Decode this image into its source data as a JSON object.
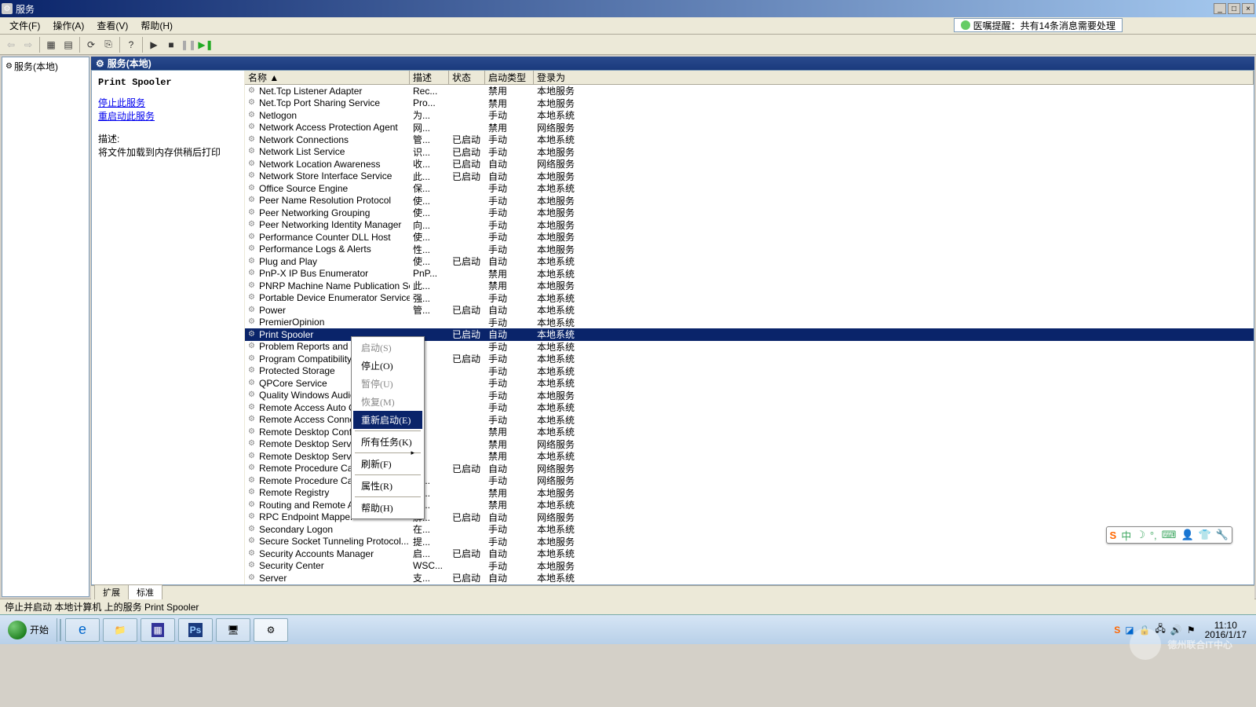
{
  "window": {
    "title": "服务",
    "btn_min": "_",
    "btn_max": "□",
    "btn_close": "×"
  },
  "menu": {
    "items": [
      "文件(F)",
      "操作(A)",
      "查看(V)",
      "帮助(H)"
    ]
  },
  "notification": "医嘱提醒：共有14条消息需要处理",
  "tree": {
    "root": "服务(本地)"
  },
  "header": "服务(本地)",
  "detail": {
    "name": "Print Spooler",
    "link_stop": "停止此服务",
    "link_restart": "重启动此服务",
    "desc_label": "描述:",
    "desc": "将文件加载到内存供稍后打印"
  },
  "columns": {
    "name": "名称 ▲",
    "desc": "描述",
    "status": "状态",
    "startup": "启动类型",
    "logon": "登录为"
  },
  "context_menu": {
    "start": "启动(S)",
    "stop": "停止(O)",
    "pause": "暂停(U)",
    "resume": "恢复(M)",
    "restart": "重新启动(E)",
    "all_tasks": "所有任务(K)",
    "refresh": "刷新(F)",
    "properties": "属性(R)",
    "help": "帮助(H)"
  },
  "tabs": {
    "extended": "扩展",
    "standard": "标准"
  },
  "status_bar": "停止并启动 本地计算机 上的服务 Print Spooler",
  "taskbar": {
    "start": "开始",
    "time": "11:10",
    "date": "2016/1/17"
  },
  "watermark": "德州联合IT中心",
  "services": [
    {
      "n": "Net.Tcp Listener Adapter",
      "d": "Rec...",
      "s": "",
      "t": "禁用",
      "l": "本地服务"
    },
    {
      "n": "Net.Tcp Port Sharing Service",
      "d": "Pro...",
      "s": "",
      "t": "禁用",
      "l": "本地服务"
    },
    {
      "n": "Netlogon",
      "d": "为...",
      "s": "",
      "t": "手动",
      "l": "本地系统"
    },
    {
      "n": "Network Access Protection Agent",
      "d": "网...",
      "s": "",
      "t": "禁用",
      "l": "网络服务"
    },
    {
      "n": "Network Connections",
      "d": "管...",
      "s": "已启动",
      "t": "手动",
      "l": "本地系统"
    },
    {
      "n": "Network List Service",
      "d": "识...",
      "s": "已启动",
      "t": "手动",
      "l": "本地服务"
    },
    {
      "n": "Network Location Awareness",
      "d": "收...",
      "s": "已启动",
      "t": "自动",
      "l": "网络服务"
    },
    {
      "n": "Network Store Interface Service",
      "d": "此...",
      "s": "已启动",
      "t": "自动",
      "l": "本地服务"
    },
    {
      "n": "Office Source Engine",
      "d": "保...",
      "s": "",
      "t": "手动",
      "l": "本地系统"
    },
    {
      "n": "Peer Name Resolution Protocol",
      "d": "使...",
      "s": "",
      "t": "手动",
      "l": "本地服务"
    },
    {
      "n": "Peer Networking Grouping",
      "d": "使...",
      "s": "",
      "t": "手动",
      "l": "本地服务"
    },
    {
      "n": "Peer Networking Identity Manager",
      "d": "向...",
      "s": "",
      "t": "手动",
      "l": "本地服务"
    },
    {
      "n": "Performance Counter DLL Host",
      "d": "使...",
      "s": "",
      "t": "手动",
      "l": "本地服务"
    },
    {
      "n": "Performance Logs & Alerts",
      "d": "性...",
      "s": "",
      "t": "手动",
      "l": "本地服务"
    },
    {
      "n": "Plug and Play",
      "d": "使...",
      "s": "已启动",
      "t": "自动",
      "l": "本地系统"
    },
    {
      "n": "PnP-X IP Bus Enumerator",
      "d": "PnP...",
      "s": "",
      "t": "禁用",
      "l": "本地系统"
    },
    {
      "n": "PNRP Machine Name Publication Se...",
      "d": "此...",
      "s": "",
      "t": "禁用",
      "l": "本地服务"
    },
    {
      "n": "Portable Device Enumerator Service",
      "d": "强...",
      "s": "",
      "t": "手动",
      "l": "本地系统"
    },
    {
      "n": "Power",
      "d": "管...",
      "s": "已启动",
      "t": "自动",
      "l": "本地系统"
    },
    {
      "n": "PremierOpinion",
      "d": "",
      "s": "",
      "t": "手动",
      "l": "本地系统"
    },
    {
      "n": "Print Spooler",
      "d": "",
      "s": "已启动",
      "t": "自动",
      "l": "本地系统",
      "sel": true
    },
    {
      "n": "Problem Reports and S",
      "d": "",
      "s": "",
      "t": "手动",
      "l": "本地系统"
    },
    {
      "n": "Program Compatibility",
      "d": "",
      "s": "已启动",
      "t": "手动",
      "l": "本地系统"
    },
    {
      "n": "Protected Storage",
      "d": "",
      "s": "",
      "t": "手动",
      "l": "本地系统"
    },
    {
      "n": "QPCore Service",
      "d": "",
      "s": "",
      "t": "手动",
      "l": "本地系统"
    },
    {
      "n": "Quality Windows Audio",
      "d": "",
      "s": "",
      "t": "手动",
      "l": "本地服务"
    },
    {
      "n": "Remote Access Auto Co",
      "d": "",
      "s": "",
      "t": "手动",
      "l": "本地系统"
    },
    {
      "n": "Remote Access Connect",
      "d": "",
      "s": "",
      "t": "手动",
      "l": "本地系统"
    },
    {
      "n": "Remote Desktop Config",
      "d": "",
      "s": "",
      "t": "禁用",
      "l": "本地系统"
    },
    {
      "n": "Remote Desktop Servic",
      "d": "",
      "s": "",
      "t": "禁用",
      "l": "网络服务"
    },
    {
      "n": "Remote Desktop Servic",
      "d": "",
      "s": "",
      "t": "禁用",
      "l": "本地系统"
    },
    {
      "n": "Remote Procedure Call",
      "d": "",
      "s": "已启动",
      "t": "自动",
      "l": "网络服务"
    },
    {
      "n": "Remote Procedure Call (RPC) Locator",
      "d": "在...",
      "s": "",
      "t": "手动",
      "l": "网络服务"
    },
    {
      "n": "Remote Registry",
      "d": "使...",
      "s": "",
      "t": "禁用",
      "l": "本地服务"
    },
    {
      "n": "Routing and Remote Access",
      "d": "在...",
      "s": "",
      "t": "禁用",
      "l": "本地系统"
    },
    {
      "n": "RPC Endpoint Mapper",
      "d": "解...",
      "s": "已启动",
      "t": "自动",
      "l": "网络服务"
    },
    {
      "n": "Secondary Logon",
      "d": "在...",
      "s": "",
      "t": "手动",
      "l": "本地系统"
    },
    {
      "n": "Secure Socket Tunneling Protocol...",
      "d": "提...",
      "s": "",
      "t": "手动",
      "l": "本地服务"
    },
    {
      "n": "Security Accounts Manager",
      "d": "启...",
      "s": "已启动",
      "t": "自动",
      "l": "本地系统"
    },
    {
      "n": "Security Center",
      "d": "WSC...",
      "s": "",
      "t": "手动",
      "l": "本地服务"
    },
    {
      "n": "Server",
      "d": "支...",
      "s": "已启动",
      "t": "自动",
      "l": "本地系统"
    }
  ]
}
